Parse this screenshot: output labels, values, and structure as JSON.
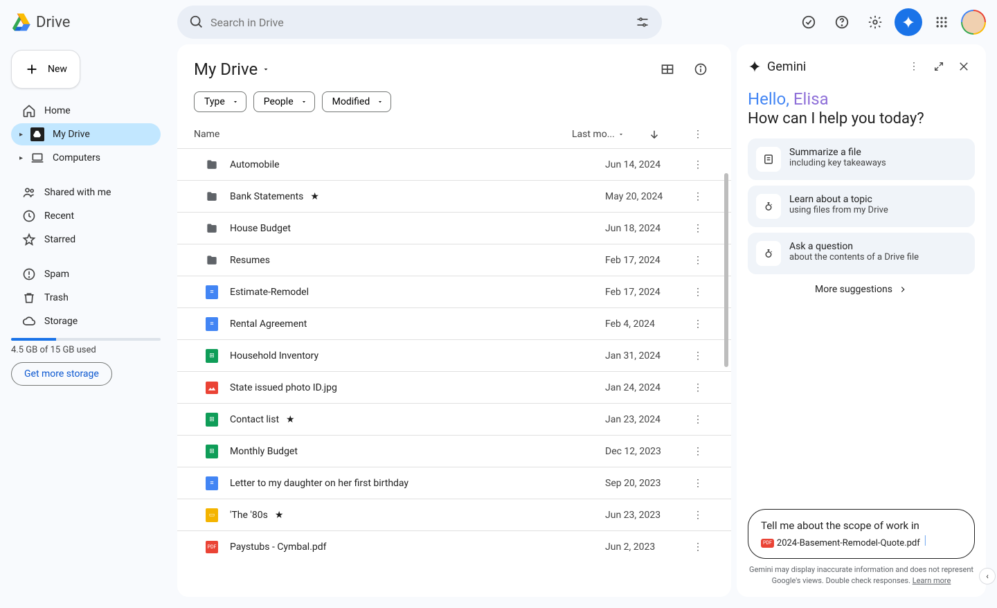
{
  "app": {
    "name": "Drive"
  },
  "search": {
    "placeholder": "Search in Drive"
  },
  "sidebar": {
    "new_label": "New",
    "items": [
      {
        "label": "Home"
      },
      {
        "label": "My Drive"
      },
      {
        "label": "Computers"
      },
      {
        "label": "Shared with me"
      },
      {
        "label": "Recent"
      },
      {
        "label": "Starred"
      },
      {
        "label": "Spam"
      },
      {
        "label": "Trash"
      },
      {
        "label": "Storage"
      }
    ],
    "storage_used": "4.5 GB of 15 GB used",
    "storage_cta": "Get more storage"
  },
  "main": {
    "title": "My Drive",
    "filters": {
      "type": "Type",
      "people": "People",
      "modified": "Modified"
    },
    "columns": {
      "name": "Name",
      "modified": "Last mo..."
    },
    "files": [
      {
        "name": "Automobile",
        "type": "folder",
        "mod": "Jun 14, 2024",
        "star": false
      },
      {
        "name": "Bank Statements",
        "type": "folder",
        "mod": "May 20, 2024",
        "star": true
      },
      {
        "name": "House Budget",
        "type": "folder",
        "mod": "Jun 18, 2024",
        "star": false
      },
      {
        "name": "Resumes",
        "type": "folder",
        "mod": "Feb 17, 2024",
        "star": false
      },
      {
        "name": "Estimate-Remodel",
        "type": "doc",
        "mod": "Feb 17, 2024",
        "star": false
      },
      {
        "name": "Rental Agreement",
        "type": "doc",
        "mod": "Feb 4, 2024",
        "star": false
      },
      {
        "name": "Household Inventory",
        "type": "sheet",
        "mod": "Jan 31, 2024",
        "star": false
      },
      {
        "name": "State issued photo ID.jpg",
        "type": "image",
        "mod": "Jan 24, 2024",
        "star": false
      },
      {
        "name": "Contact list",
        "type": "sheet",
        "mod": "Jan 23, 2024",
        "star": true
      },
      {
        "name": "Monthly Budget",
        "type": "sheet",
        "mod": "Dec 12, 2023",
        "star": false
      },
      {
        "name": "Letter to my daughter on her first birthday",
        "type": "doc",
        "mod": "Sep 20, 2023",
        "star": false
      },
      {
        "name": "'The '80s",
        "type": "slides",
        "mod": "Jun 23, 2023",
        "star": true
      },
      {
        "name": "Paystubs - Cymbal.pdf",
        "type": "pdf",
        "mod": "Jun 2, 2023",
        "star": false
      }
    ]
  },
  "gemini": {
    "title": "Gemini",
    "hello_1": "Hello, ",
    "hello_2": "Elisa",
    "subtitle": "How can I help you today?",
    "suggestions": [
      {
        "title": "Summarize a file",
        "sub": "including key takeaways"
      },
      {
        "title": "Learn about a topic",
        "sub": "using files from my Drive"
      },
      {
        "title": "Ask a question",
        "sub": "about the contents of a Drive file"
      }
    ],
    "more": "More suggestions",
    "input_text": "Tell me about the scope of work in",
    "input_chip": "2024-Basement-Remodel-Quote.pdf",
    "disclaimer_1": "Gemini may display inaccurate information and does not represent Google's views. Double check responses. ",
    "disclaimer_link": "Learn more"
  }
}
